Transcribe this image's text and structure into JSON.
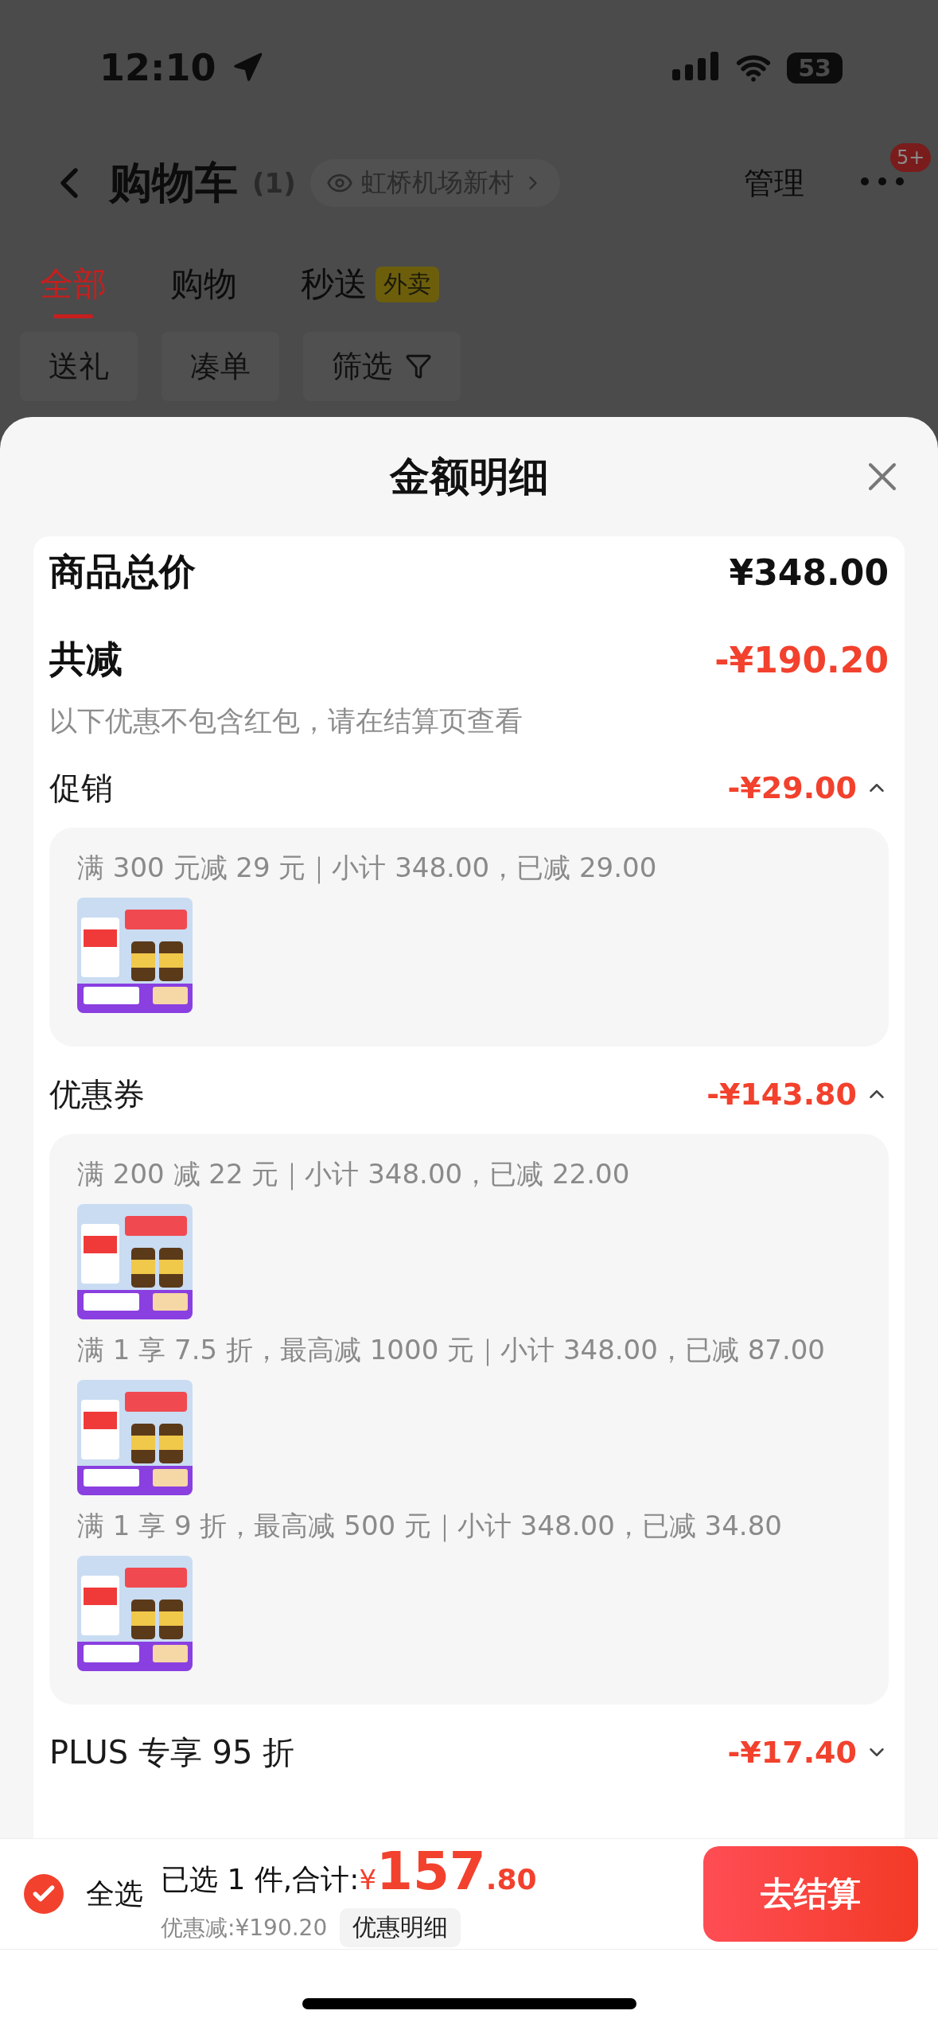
{
  "status_bar": {
    "time": "12:10",
    "battery": "53"
  },
  "header": {
    "title": "购物车",
    "count": "(1)",
    "location": "虹桥机场新村",
    "manage": "管理",
    "badge": "5+"
  },
  "tabs": [
    {
      "label": "全部",
      "selected": true
    },
    {
      "label": "购物",
      "selected": false
    },
    {
      "label": "秒送",
      "tag": "外卖",
      "selected": false
    }
  ],
  "chips": [
    {
      "label": "送礼"
    },
    {
      "label": "凑单"
    },
    {
      "label": "筛选",
      "kind": "filter"
    }
  ],
  "sheet": {
    "title": "金额明细",
    "total": {
      "label": "商品总价",
      "value": "¥348.00"
    },
    "discount": {
      "label": "共减",
      "value": "-¥190.20",
      "note": "以下优惠不包含红包，请在结算页查看"
    },
    "sections": [
      {
        "label": "促销",
        "amount": "-¥29.00",
        "expanded": true,
        "groups": [
          {
            "rule": "满 300 元减 29 元｜小计 348.00，已减 29.00"
          }
        ]
      },
      {
        "label": "优惠券",
        "amount": "-¥143.80",
        "expanded": true,
        "groups": [
          {
            "rule": "满 200 减 22 元｜小计 348.00，已减 22.00"
          },
          {
            "rule": "满 1 享 7.5 折，最高减 1000 元｜小计 348.00，已减 87.00"
          },
          {
            "rule": "满 1 享 9 折，最高减 500 元｜小计 348.00，已减 34.80"
          }
        ]
      },
      {
        "label": "PLUS 专享 95 折",
        "amount": "-¥17.40",
        "expanded": false
      }
    ]
  },
  "bottom_bar": {
    "select_all": {
      "label": "全选",
      "checked": true
    },
    "summary": "已选 1 件,合计:",
    "currency": "¥",
    "integer": "157",
    "decimal": ".80",
    "saving": "优惠减:¥190.20",
    "detail_button": "优惠明细",
    "checkout": "去结算"
  }
}
